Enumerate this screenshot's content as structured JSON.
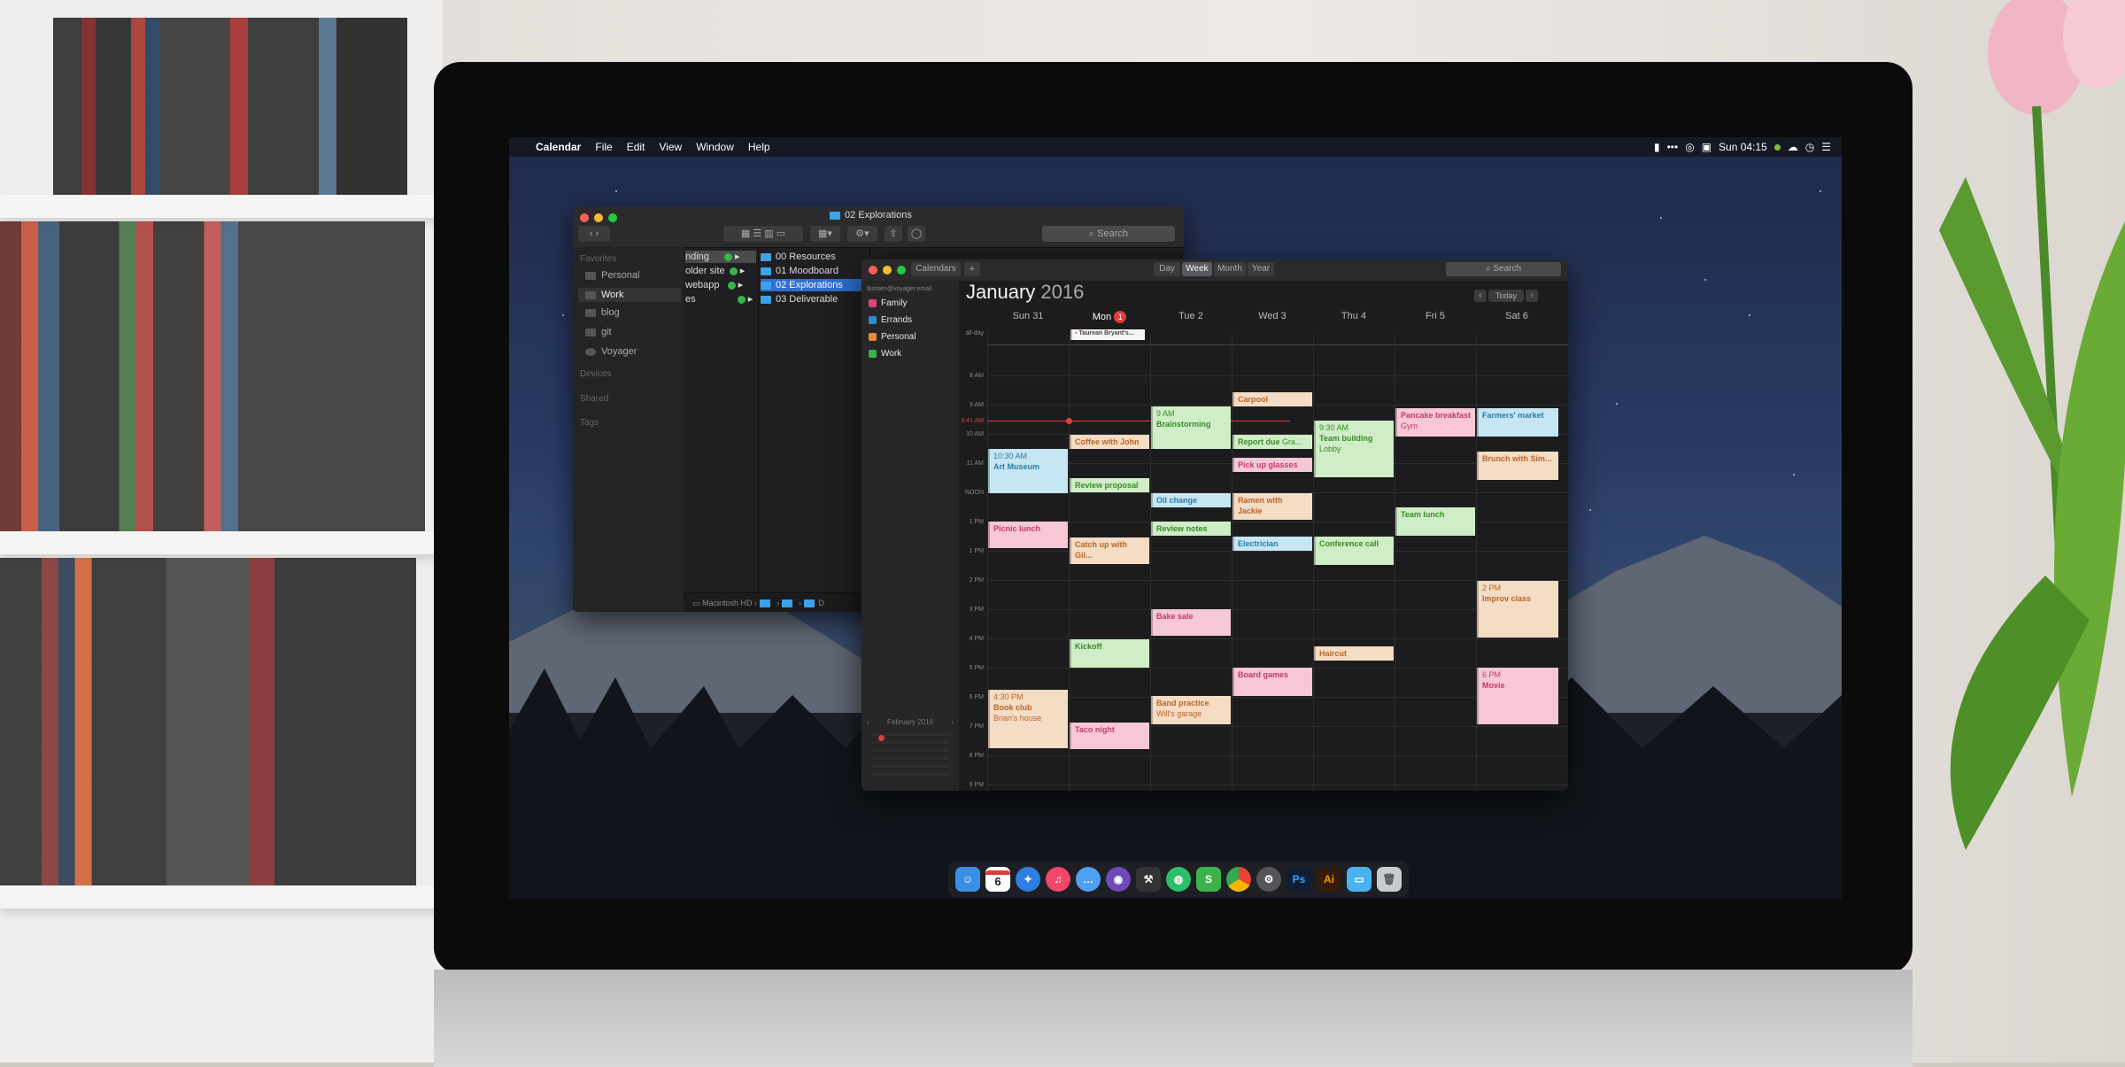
{
  "menubar": {
    "apple_glyph": "",
    "app_name": "Calendar",
    "items": [
      "File",
      "Edit",
      "View",
      "Window",
      "Help"
    ],
    "clock": "Sun 04:15"
  },
  "finder": {
    "title": "02 Explorations",
    "search_placeholder": "Search",
    "sidebar": {
      "favorites_header": "Favorites",
      "favorites": [
        "Personal",
        "Work",
        "blog",
        "git",
        "Voyager"
      ],
      "devices_header": "Devices",
      "shared_header": "Shared",
      "tags_header": "Tags"
    },
    "col1": [
      "nding",
      "older site",
      "webapp",
      "es"
    ],
    "col2": [
      "00 Resources",
      "01 Moodboard",
      "02 Explorations",
      "03 Deliverable"
    ],
    "path": [
      "Macintosh HD",
      "",
      "",
      "D"
    ]
  },
  "calendar": {
    "toolbar": {
      "calendars_button": "Calendars",
      "add_button": "+",
      "views": [
        "Day",
        "Week",
        "Month",
        "Year"
      ],
      "active_view": "Week",
      "search_placeholder": "Search",
      "today_button": "Today"
    },
    "account": "tkorsen@voyager.email",
    "calendars": [
      {
        "name": "Family",
        "color": "#e0427a"
      },
      {
        "name": "Errands",
        "color": "#2a8fd1"
      },
      {
        "name": "Personal",
        "color": "#e8893a"
      },
      {
        "name": "Work",
        "color": "#3ab54a"
      }
    ],
    "mini_month": "February 2016",
    "month": "January",
    "year": "2016",
    "days": [
      "Sun 31",
      "Mon",
      "Tue 2",
      "Wed 3",
      "Thu 4",
      "Fri 5",
      "Sat 6"
    ],
    "mon_badge": "1",
    "allday_label": "all-day",
    "allday_event": "Taurean Bryant's...",
    "hours": [
      "8 AM",
      "9 AM",
      "10 AM",
      "11 AM",
      "NOON",
      "1 PM",
      "1 PM",
      "2 PM",
      "3 PM",
      "4 PM",
      "5 PM",
      "6 PM",
      "7 PM",
      "8 PM",
      "9 PM"
    ],
    "now_label": "9:41 AM",
    "events": {
      "art_museum_time": "10:30 AM",
      "art_museum": "Art Museum",
      "picnic_lunch": "Picnic lunch",
      "book_club_time": "4:30 PM",
      "book_club": "Book club",
      "book_club_loc": "Brian's house",
      "coffee": "Coffee with John",
      "review_proposal": "Review proposal",
      "catch_up": "Catch up with Gil...",
      "kickoff": "Kickoff",
      "taco_night": "Taco night",
      "brainstorm_time": "9 AM",
      "brainstorming": "Brainstorming",
      "oil_change": "Oil change",
      "review_notes": "Review notes",
      "bake_sale": "Bake sale",
      "band_practice": "Band practice",
      "band_practice_loc": "Will's garage",
      "carpool": "Carpool",
      "report_due": "Report due",
      "report_due_sub": "Gra...",
      "pick_up_glasses": "Pick up glasses",
      "ramen": "Ramen with Jackie",
      "electrician": "Electrician",
      "board_games": "Board games",
      "team_building_time": "9:30 AM",
      "team_building": "Team building",
      "team_building_loc": "Lobby",
      "conference_call": "Conference call",
      "haircut": "Haircut",
      "pancake": "Pancake breakfast",
      "pancake_sub": "Gym",
      "team_lunch": "Team lunch",
      "farmers_market": "Farmers' market",
      "brunch": "Brunch with Sim...",
      "improv_time": "2 PM",
      "improv": "Improv class",
      "movie_time": "6 PM",
      "movie": "Movie"
    }
  },
  "dock": {
    "calendar_day": "6",
    "items": [
      "finder-icon",
      "calendar-icon",
      "safari-icon",
      "music-icon",
      "messages-icon",
      "github-icon",
      "tools-icon",
      "maps-icon",
      "sketch-icon",
      "chrome-icon",
      "settings-icon",
      "photoshop-icon",
      "illustrator-icon",
      "folder-icon",
      "trash-icon"
    ],
    "ps_label": "Ps",
    "ai_label": "Ai"
  }
}
